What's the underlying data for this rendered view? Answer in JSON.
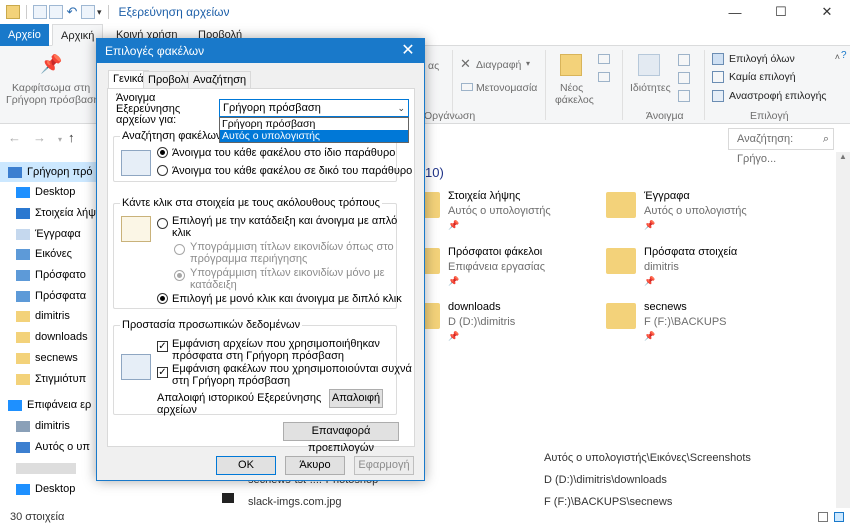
{
  "window": {
    "title": "Εξερεύνηση αρχείων",
    "controls": [
      "—",
      "☐",
      "✕"
    ]
  },
  "ribbon": {
    "tabs": [
      "Αρχείο",
      "Αρχική",
      "Κοινή χρήση",
      "Προβολή"
    ],
    "pin_label_1": "Καρφίτσωμα στη",
    "pin_label_2": "Γρήγορη πρόσβαση",
    "delete_label": "Διαγραφή",
    "rename_label": "Μετονομασία",
    "organize_label": "Οργάνωση",
    "new_folder_1": "Νέος",
    "new_folder_2": "φάκελος",
    "properties_label": "Ιδιότητες",
    "open_group": "Άνοιγμα",
    "select_all": "Επιλογή όλων",
    "select_none": "Καμία επιλογή",
    "invert_selection": "Αναστροφή επιλογής",
    "select_group": "Επιλογή",
    "partial_as": "ας"
  },
  "search": {
    "placeholder": "Αναζήτηση: Γρήγο..."
  },
  "navpane": [
    {
      "label": "Γρήγορη πρό",
      "icon": "star-icon",
      "color": "#3c7fd0"
    },
    {
      "label": "Desktop",
      "icon": "desktop-icon",
      "color": "#1e90ff"
    },
    {
      "label": "Στοιχεία λήψ",
      "icon": "download-icon",
      "color": "#2b78d0"
    },
    {
      "label": "Έγγραφα",
      "icon": "documents-icon",
      "color": "#c5d8ee"
    },
    {
      "label": "Εικόνες",
      "icon": "pictures-icon",
      "color": "#5d9ad8"
    },
    {
      "label": "Πρόσφατο",
      "icon": "recent-icon",
      "color": "#5d9ad8"
    },
    {
      "label": "Πρόσφατα",
      "icon": "recent-files-icon",
      "color": "#5d9ad8"
    },
    {
      "label": "dimitris",
      "icon": "folder-icon",
      "color": "#f3d27a"
    },
    {
      "label": "downloads",
      "icon": "folder-icon",
      "color": "#f3d27a"
    },
    {
      "label": "secnews",
      "icon": "folder-icon",
      "color": "#f3d27a"
    },
    {
      "label": "Στιγμιότυπ",
      "icon": "folder-icon",
      "color": "#f3d27a"
    },
    {
      "label": "Επιφάνεια ερ",
      "icon": "desktop-icon",
      "color": "#1e90ff"
    },
    {
      "label": "dimitris",
      "icon": "user-icon",
      "color": "#8aa0b8"
    },
    {
      "label": "Αυτός ο υπ",
      "icon": "computer-icon",
      "color": "#3c7fd0"
    },
    {
      "label": "",
      "icon": "blurred-icon",
      "color": "#dddddd"
    },
    {
      "label": "Desktop",
      "icon": "desktop-icon",
      "color": "#1e90ff"
    }
  ],
  "content": {
    "group_count": "10)",
    "tiles": [
      {
        "name": "Στοιχεία λήψης",
        "sub": "Αυτός ο υπολογιστής"
      },
      {
        "name": "Έγγραφα",
        "sub": "Αυτός ο υπολογιστής"
      },
      {
        "name": "Πρόσφατοι φάκελοι",
        "sub": "Επιφάνεια εργασίας"
      },
      {
        "name": "Πρόσφατα στοιχεία",
        "sub": "dimitris"
      },
      {
        "name": "downloads",
        "sub": "D (D:)\\dimitris"
      },
      {
        "name": "secnews",
        "sub": "F (F:)\\BACKUPS"
      }
    ],
    "paths": [
      "Αυτός ο υπολογιστής\\Εικόνες\\Screenshots",
      "D (D:)\\dimitris\\downloads",
      "F (F:)\\BACKUPS\\secnews"
    ],
    "files": [
      "secnews-tst-....-Photoshop",
      "slack-imgs.com.jpg"
    ]
  },
  "status": {
    "count": "30 στοιχεία"
  },
  "dialog": {
    "title": "Επιλογές φακέλων",
    "tabs": [
      "Γενικά",
      "Προβολή",
      "Αναζήτηση"
    ],
    "open_label": "Άνοιγμα Εξερεύνησης αρχείων για:",
    "combo_value": "Γρήγορη πρόσβαση",
    "combo_options": [
      "Γρήγορη πρόσβαση",
      "Αυτός ο υπολογιστής"
    ],
    "browse": {
      "legend": "Αναζήτηση φακέλων",
      "opt1": "Άνοιγμα του κάθε φακέλου στο ίδιο παράθυρο",
      "opt2": "Άνοιγμα του κάθε φακέλου σε δικό του παράθυρο"
    },
    "click": {
      "legend": "Κάντε κλικ στα στοιχεία με τους ακόλουθους τρόπους",
      "opt1a": "Επιλογή με την κατάδειξη και άνοιγμα με απλό",
      "opt1b": "κλικ",
      "sub1a": "Υπογράμμιση τίτλων εικονιδίων όπως στο",
      "sub1b": "πρόγραμμα περιήγησης",
      "sub2a": "Υπογράμμιση τίτλων εικονιδίων μόνο με",
      "sub2b": "κατάδειξη",
      "opt2": "Επιλογή με μονό κλικ και άνοιγμα με διπλό κλικ"
    },
    "privacy": {
      "legend": "Προστασία προσωπικών δεδομένων",
      "chk1a": "Εμφάνιση αρχείων που χρησιμοποιήθηκαν",
      "chk1b": "πρόσφατα στη Γρήγορη πρόσβαση",
      "chk2a": "Εμφάνιση φακέλων που χρησιμοποιούνται συχνά",
      "chk2b": "στη Γρήγορη πρόσβαση",
      "clear_text_1": "Απαλοιφή ιστορικού Εξερεύνησης",
      "clear_text_2": "αρχείων",
      "clear_button": "Απαλοιφή"
    },
    "restore_button": "Επαναφορά προεπιλογών",
    "ok": "OK",
    "cancel": "Άκυρο",
    "apply": "Εφαρμογή"
  }
}
